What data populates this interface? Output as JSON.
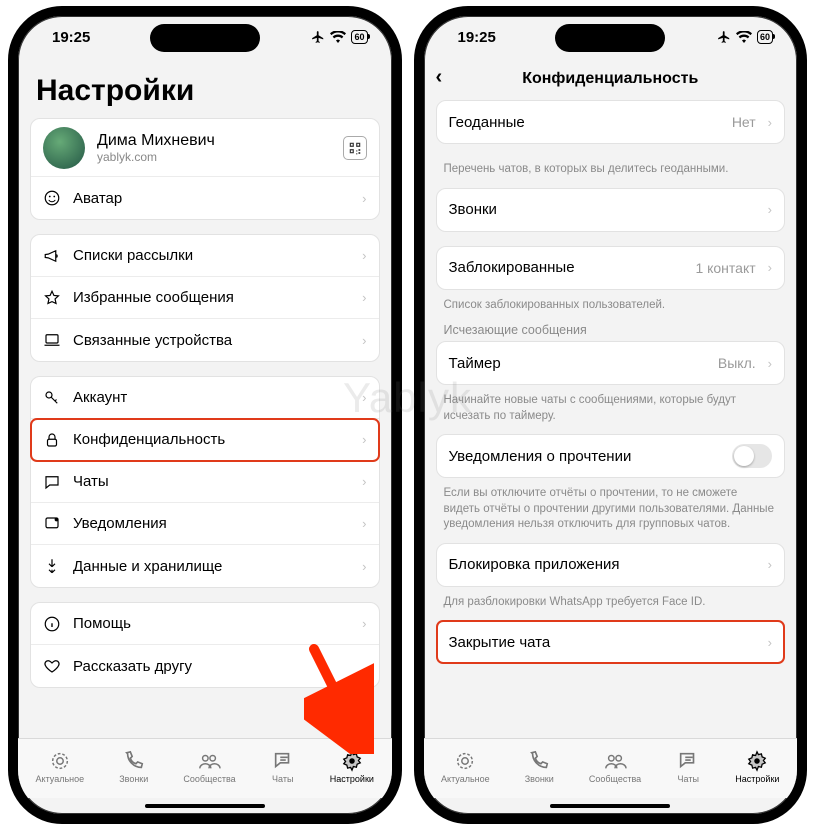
{
  "watermark": "Yablyk",
  "status": {
    "time": "19:25",
    "battery": "60"
  },
  "left": {
    "title": "Настройки",
    "profile": {
      "name": "Дима Михневич",
      "sub": "yablyk.com"
    },
    "avatar_row": "Аватар",
    "group2": {
      "broadcast": "Списки рассылки",
      "starred": "Избранные сообщения",
      "linked": "Связанные устройства"
    },
    "group3": {
      "account": "Аккаунт",
      "privacy": "Конфиденциальность",
      "chats": "Чаты",
      "notifications": "Уведомления",
      "storage": "Данные и хранилище"
    },
    "group4": {
      "help": "Помощь",
      "tell": "Рассказать другу"
    }
  },
  "right": {
    "nav_title": "Конфиденциальность",
    "geo": {
      "label": "Геоданные",
      "value": "Нет",
      "foot": "Перечень чатов, в которых вы делитесь геоданными."
    },
    "calls": "Звонки",
    "blocked": {
      "label": "Заблокированные",
      "value": "1 контакт",
      "foot": "Список заблокированных пользователей."
    },
    "disappearing_header": "Исчезающие сообщения",
    "timer": {
      "label": "Таймер",
      "value": "Выкл.",
      "foot": "Начинайте новые чаты с сообщениями, которые будут исчезать по таймеру."
    },
    "read_receipts": {
      "label": "Уведомления о прочтении",
      "foot": "Если вы отключите отчёты о прочтении, то не сможете видеть отчёты о прочтении другими пользователями. Данные уведомления нельзя отключить для групповых чатов."
    },
    "app_lock": {
      "label": "Блокировка приложения",
      "foot": "Для разблокировки WhatsApp требуется Face ID."
    },
    "chat_lock": "Закрытие чата"
  },
  "tabs": {
    "t0": "Актуальное",
    "t1": "Звонки",
    "t2": "Сообщества",
    "t3": "Чаты",
    "t4": "Настройки"
  }
}
